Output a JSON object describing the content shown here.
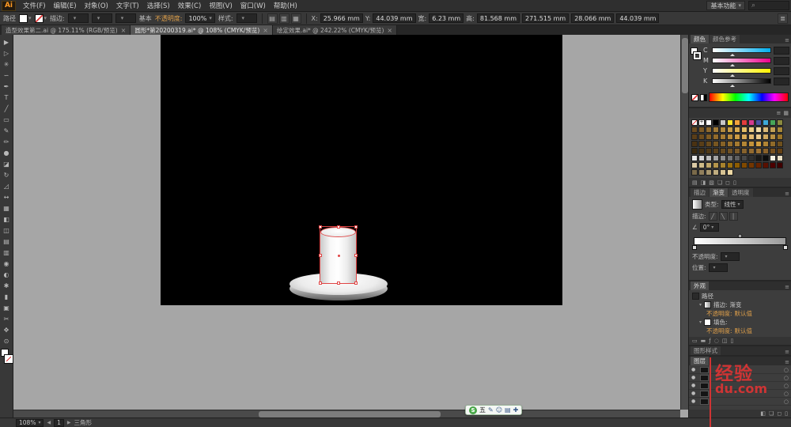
{
  "app": {
    "logo": "Ai",
    "menu_items": [
      "文件(F)",
      "编辑(E)",
      "对象(O)",
      "文字(T)",
      "选择(S)",
      "效果(C)",
      "视图(V)",
      "窗口(W)",
      "帮助(H)"
    ],
    "workspace_label": "基本功能"
  },
  "control_bar": {
    "selection_label": "路径",
    "stroke_label": "描边:",
    "basic_label": "基本",
    "opacity_label": "不透明度:",
    "opacity_value": "100%",
    "style_label": "样式:",
    "align_icons": [
      {
        "name": "align-left-icon",
        "glyph": "▤"
      },
      {
        "name": "align-center-icon",
        "glyph": "▥"
      },
      {
        "name": "align-right-icon",
        "glyph": "▦"
      }
    ],
    "fields": [
      {
        "label": "X:",
        "value": "25.966 mm"
      },
      {
        "label": "Y:",
        "value": "44.039 mm"
      },
      {
        "label": "宽:",
        "value": "6.23 mm"
      },
      {
        "label": "高:",
        "value": "81.568 mm"
      },
      {
        "label": "",
        "value": "271.515 mm"
      },
      {
        "label": "",
        "value": "28.066 mm"
      },
      {
        "label": "",
        "value": "44.039 mm"
      }
    ]
  },
  "document_tabs": [
    {
      "title": "造型效果第二.ai @ 175.11% (RGB/预览)",
      "active": false
    },
    {
      "title": "圆形*第20200319.ai* @ 108% (CMYK/预览)",
      "active": true
    },
    {
      "title": "绘定效果.ai* @ 242.22% (CMYK/预览)",
      "active": false
    }
  ],
  "tools": [
    {
      "name": "selection-tool",
      "glyph": "▶"
    },
    {
      "name": "direct-selection-tool",
      "glyph": "▷"
    },
    {
      "name": "magic-wand-tool",
      "glyph": "✳"
    },
    {
      "name": "lasso-tool",
      "glyph": "∽"
    },
    {
      "name": "pen-tool",
      "glyph": "✒"
    },
    {
      "name": "type-tool",
      "glyph": "T"
    },
    {
      "name": "line-segment-tool",
      "glyph": "╱"
    },
    {
      "name": "rectangle-tool",
      "glyph": "▭"
    },
    {
      "name": "paintbrush-tool",
      "glyph": "✎"
    },
    {
      "name": "pencil-tool",
      "glyph": "✏"
    },
    {
      "name": "blob-brush-tool",
      "glyph": "●"
    },
    {
      "name": "eraser-tool",
      "glyph": "◪"
    },
    {
      "name": "rotate-tool",
      "glyph": "↻"
    },
    {
      "name": "scale-tool",
      "glyph": "◿"
    },
    {
      "name": "width-tool",
      "glyph": "↔"
    },
    {
      "name": "free-transform-tool",
      "glyph": "▦"
    },
    {
      "name": "shape-builder-tool",
      "glyph": "◧"
    },
    {
      "name": "perspective-grid-tool",
      "glyph": "◫"
    },
    {
      "name": "mesh-tool",
      "glyph": "▤"
    },
    {
      "name": "gradient-tool",
      "glyph": "▥"
    },
    {
      "name": "eyedropper-tool",
      "glyph": "◉"
    },
    {
      "name": "blend-tool",
      "glyph": "◐"
    },
    {
      "name": "symbol-sprayer-tool",
      "glyph": "✱"
    },
    {
      "name": "column-graph-tool",
      "glyph": "▮"
    },
    {
      "name": "artboard-tool",
      "glyph": "▣"
    },
    {
      "name": "slice-tool",
      "glyph": "✂"
    },
    {
      "name": "hand-tool",
      "glyph": "✥"
    },
    {
      "name": "zoom-tool",
      "glyph": "⊙"
    }
  ],
  "color_panel": {
    "tabs": [
      "颜色",
      "颜色参考"
    ],
    "channels": [
      {
        "letter": "C",
        "color": "#00aeef"
      },
      {
        "letter": "M",
        "color": "#ec008c"
      },
      {
        "letter": "Y",
        "color": "#fff200"
      },
      {
        "letter": "K",
        "color": "#000000"
      }
    ]
  },
  "swatches": {
    "rows": [
      [
        "none",
        "reg",
        "#ffffff",
        "#000000",
        "#c7c7c7",
        "#f7e52c",
        "#f2a33c",
        "#e23d3d",
        "#d43b8e",
        "#4a52a3",
        "#3fa9d9",
        "#46a558",
        "#8a8a3f"
      ],
      [
        "#6b4a1f",
        "#7d5a26",
        "#8f6a2e",
        "#a17a36",
        "#b38a3e",
        "#c59a46",
        "#d7ab50",
        "#e3bc66",
        "#eccd85",
        "#f2dca5",
        "#d9b878",
        "#c0a055",
        "#a78838"
      ],
      [
        "#5a3d17",
        "#6d4c1d",
        "#805c24",
        "#936b2b",
        "#a67b33",
        "#b98b3b",
        "#cc9b44",
        "#d9ab58",
        "#e3bb72",
        "#eccb8f",
        "#d1a960",
        "#b68f42",
        "#9b7528"
      ],
      [
        "#4a3212",
        "#593e17",
        "#684a1c",
        "#775621",
        "#866226",
        "#956e2b",
        "#a47a30",
        "#b38635",
        "#c2923a",
        "#d19e3f",
        "#b08434",
        "#8f6a29",
        "#6e501e"
      ],
      [
        "#3a2a10",
        "#453214",
        "#503a18",
        "#5b421c",
        "#664a20",
        "#715224",
        "#7c5a28",
        "#87622c",
        "#926a30",
        "#9d7234",
        "#8a6129",
        "#77501e",
        "#644013"
      ],
      [
        "#e8e8e8",
        "#d1d1d1",
        "#bababa",
        "#a3a3a3",
        "#8c8c8c",
        "#757575",
        "#5e5e5e",
        "#474747",
        "#303030",
        "#191919",
        "#0d0d0d",
        "#f5f0e1",
        "#e8ddc3"
      ],
      [
        "#dbcaa5",
        "#cebb87",
        "#c1a869",
        "#b4954b",
        "#a7822d",
        "#9a6f0f",
        "#8d5c00",
        "#804900",
        "#733600",
        "#662300",
        "#591000",
        "#4c0000",
        "#3f0000"
      ],
      [
        "#7a6a4a",
        "#91805c",
        "#a8966e",
        "#bfac80",
        "#d6c292",
        "#edd8a4"
      ]
    ],
    "header_icons": [
      {
        "name": "list-view-icon",
        "glyph": "≡"
      },
      {
        "name": "grid-view-icon",
        "glyph": "▦"
      }
    ],
    "footer_icons": [
      {
        "name": "swatch-libraries-icon",
        "glyph": "▤"
      },
      {
        "name": "swatch-kinds-icon",
        "glyph": "◨"
      },
      {
        "name": "swatch-options-icon",
        "glyph": "▧"
      },
      {
        "name": "new-group-icon",
        "glyph": "❏"
      },
      {
        "name": "new-swatch-icon",
        "glyph": "◻"
      },
      {
        "name": "delete-swatch-icon",
        "glyph": "▯"
      }
    ]
  },
  "gradient_panel": {
    "tabs": [
      "描边",
      "渐变",
      "透明度"
    ],
    "type_label": "类型:",
    "type_value": "线性",
    "stroke_label": "描边:",
    "angle_label": "∠",
    "angle_value": "0°",
    "opacity_label": "不透明度:",
    "location_label": "位置:"
  },
  "appearance_panel": {
    "tab": "外观",
    "rows": [
      {
        "label": "路径",
        "value": "",
        "thumb": "path",
        "indent": 0,
        "muted": false,
        "caret": false
      },
      {
        "label": "描边:",
        "value": "渐变",
        "thumb": "grad",
        "indent": 1,
        "muted": false,
        "caret": true
      },
      {
        "label": "不透明度:",
        "value": "默认值",
        "thumb": "",
        "indent": 2,
        "muted": true,
        "caret": false
      },
      {
        "label": "填色:",
        "value": "",
        "thumb": "fill",
        "indent": 1,
        "muted": false,
        "caret": true
      },
      {
        "label": "不透明度:",
        "value": "默认值",
        "thumb": "",
        "indent": 2,
        "muted": true,
        "caret": false
      }
    ],
    "footer_icons": [
      {
        "name": "new-stroke-icon",
        "glyph": "▭"
      },
      {
        "name": "new-fill-icon",
        "glyph": "▬"
      },
      {
        "name": "effects-icon",
        "glyph": "ƒ"
      },
      {
        "name": "clear-appearance-icon",
        "glyph": "◌"
      },
      {
        "name": "duplicate-item-icon",
        "glyph": "◫"
      },
      {
        "name": "delete-item-icon",
        "glyph": "▯"
      }
    ]
  },
  "graphic_styles_tab": "图形样式",
  "layers_panel": {
    "tab": "图层",
    "row_count": 5,
    "footer_icons": [
      {
        "name": "make-mask-icon",
        "glyph": "◧"
      },
      {
        "name": "new-sublayer-icon",
        "glyph": "❏"
      },
      {
        "name": "new-layer-icon",
        "glyph": "◻"
      },
      {
        "name": "delete-layer-icon",
        "glyph": "▯"
      }
    ]
  },
  "ime_bar": {
    "items": [
      {
        "name": "sogou-logo",
        "glyph": "S",
        "kind": "logo"
      },
      {
        "name": "ime-mode-label",
        "glyph": "五",
        "kind": "mode"
      },
      {
        "name": "pen-icon",
        "glyph": "✎",
        "kind": "icon"
      },
      {
        "name": "emoji-icon",
        "glyph": "☺",
        "kind": "icon"
      },
      {
        "name": "keyboard-icon",
        "glyph": "▤",
        "kind": "icon"
      },
      {
        "name": "toolbox-icon",
        "glyph": "✚",
        "kind": "icon"
      }
    ]
  },
  "watermark": {
    "line1": "经验",
    "line2": "du.com",
    "color": "#cf3434"
  },
  "status_bar": {
    "zoom": "108%",
    "artboard": "1",
    "label": "三角形"
  }
}
